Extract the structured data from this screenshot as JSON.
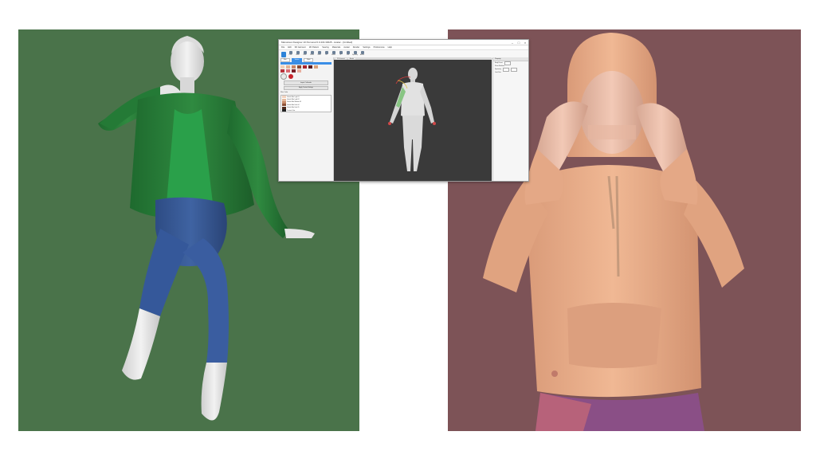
{
  "app": {
    "title": "Marvelous Designer 10 Personal 6.0.434.33025 - Avatar - [Untitled]",
    "menu": [
      "File",
      "Edit",
      "3D Garment",
      "2D Pattern",
      "Sewing",
      "Materials",
      "Avatar",
      "Render",
      "Settings",
      "Preferences",
      "Help"
    ],
    "toolbar_tools": [
      "Pose",
      "Mirror",
      "Move",
      "Rotate",
      "Scale",
      "Pin",
      "Freeze",
      "IK",
      "Joint",
      "Symmetry",
      "Anchor"
    ],
    "left_tabs": [
      "Skin",
      "Texture",
      "Eyes"
    ],
    "left_buttons": [
      "Import Ceftinader",
      "Apply Texture Settings"
    ],
    "color_section_label": "Skin Color",
    "color_list": [
      "Default Skin Light 01",
      "Default Skin Light 02",
      "Default Skin Medium 03",
      "Default Skin Dark 04",
      "Default Skin Dark 05",
      "Custom Color"
    ],
    "viewport_tabs": [
      "3D Garment",
      "Avatar"
    ],
    "right_panel": {
      "header": "Property",
      "rows": [
        "Body Preset",
        "Show Skeleton",
        "Symmetry",
        "Joint Size"
      ]
    }
  },
  "colors": {
    "left_bg": "#4a734a",
    "right_bg": "#7d5357",
    "accent": "#3a8ee6",
    "viewport": "#3a3a3a"
  }
}
